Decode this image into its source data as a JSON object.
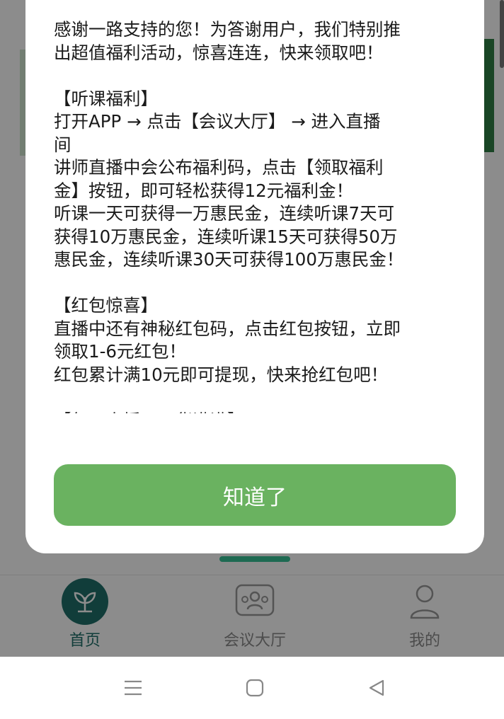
{
  "modal": {
    "lines": [
      "感谢一路支持的您！为答谢用户，我们特别推",
      "出超值福利活动，惊喜连连，快来领取吧！",
      "",
      "【听课福利】",
      "打开APP → 点击【会议大厅】 → 进入直播",
      "间",
      "讲师直播中会公布福利码，点击【领取福利",
      "金】按钮，即可轻松获得12元福利金！",
      "听课一天可获得一万惠民金，连续听课7天可",
      "获得10万惠民金，连续听课15天可获得50万",
      "惠民金，连续听课30天可获得100万惠民金！",
      "",
      "【红包惊喜】",
      "直播中还有神秘红包码，点击红包按钮，立即",
      "领取1-6元红包！",
      "红包累计满10元即可提现，快来抢红包吧！",
      "",
      "【每日直播，干货满满】"
    ],
    "button_label": "知道了"
  },
  "tabbar": {
    "items": [
      {
        "label": "首页",
        "icon": "leaf-icon",
        "active": true
      },
      {
        "label": "会议大厅",
        "icon": "group-icon",
        "active": false
      },
      {
        "label": "我的",
        "icon": "user-icon",
        "active": false
      }
    ]
  },
  "system_nav": {
    "icons": [
      "menu-icon",
      "home-square-icon",
      "back-triangle-icon"
    ]
  },
  "colors": {
    "accent_button": "#6ab260",
    "active_tab": "#1f6f6a",
    "overlay": "rgba(0,0,0,0.45)"
  }
}
